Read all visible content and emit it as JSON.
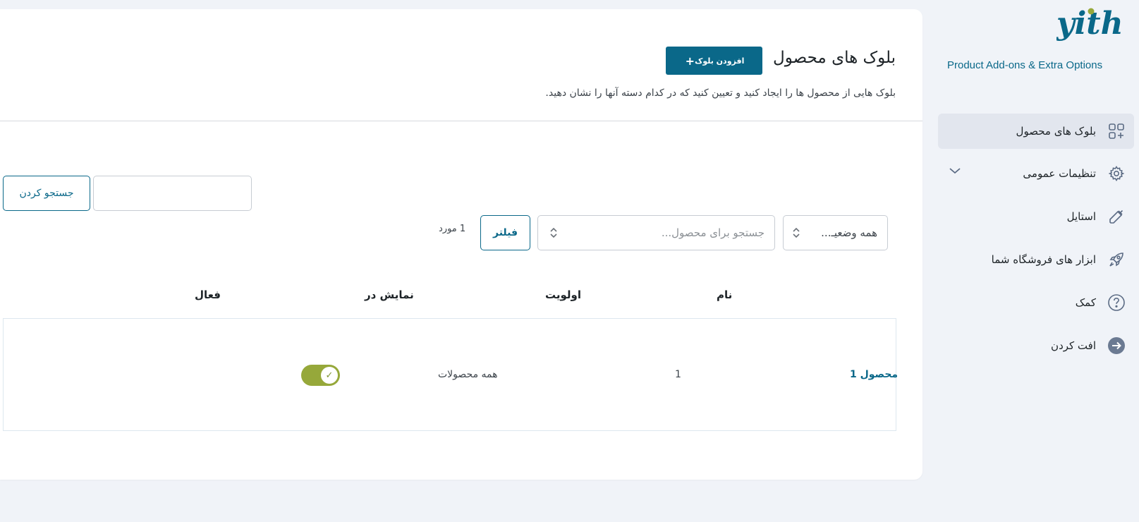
{
  "header": {
    "title": "بلوک های محصول",
    "add_button_label": "افزودن بلوک",
    "description": "بلوک هایی از محصول ها را ایجاد کنید و تعیین کنید که در کدام دسته آنها را نشان دهید."
  },
  "search": {
    "input_value": "",
    "button_label": "جستجو کردن"
  },
  "filters": {
    "status_select_value": "همه وضعیـ...",
    "product_select_placeholder": "جستجو برای محصول...",
    "filter_button_label": "فیلتر",
    "items_count": "1 مورد"
  },
  "table": {
    "columns": [
      "نام",
      "اولویت",
      "نمایش در",
      "فعال"
    ],
    "rows": [
      {
        "name": "محصول 1",
        "priority": "1",
        "show_in": "همه محصولات",
        "active": true
      }
    ]
  },
  "sidebar": {
    "logo_text": "yith",
    "plugin_name": "Product Add-ons & Extra Options",
    "items": [
      {
        "label": "بلوک های محصول",
        "icon": "blocks-add-icon",
        "active": true
      },
      {
        "label": "تنظیمات عمومی",
        "icon": "gear-icon",
        "active": false,
        "has_submenu": true
      },
      {
        "label": "استایل",
        "icon": "eyedropper-icon",
        "active": false
      },
      {
        "label": "ابزار های فروشگاه شما",
        "icon": "rocket-icon",
        "active": false
      },
      {
        "label": "کمک",
        "icon": "help-circle-icon",
        "active": false
      },
      {
        "label": "افت کردن",
        "icon": "arrow-circle-icon",
        "active": false
      }
    ]
  },
  "colors": {
    "primary": "#0a6889",
    "toggle_on": "#96a83a",
    "background": "#f0f3f8",
    "active_nav": "#e2e6ee"
  }
}
